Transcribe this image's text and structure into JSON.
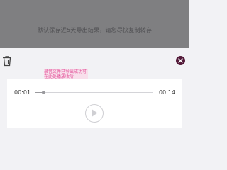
{
  "backdrop": {
    "notice": "默认保存近5天导出结果，请您尽快复制转存"
  },
  "sheet": {
    "filename": "录音文件已导出成功可在此处播放收听"
  },
  "player": {
    "elapsed": "00:01",
    "total": "00:14",
    "progress_fraction": 0.07
  },
  "icons": {
    "trash": "trash-icon",
    "close": "close-icon",
    "play": "play-icon"
  },
  "colors": {
    "accent": "#541b3a",
    "highlight_text": "#e34f98"
  }
}
